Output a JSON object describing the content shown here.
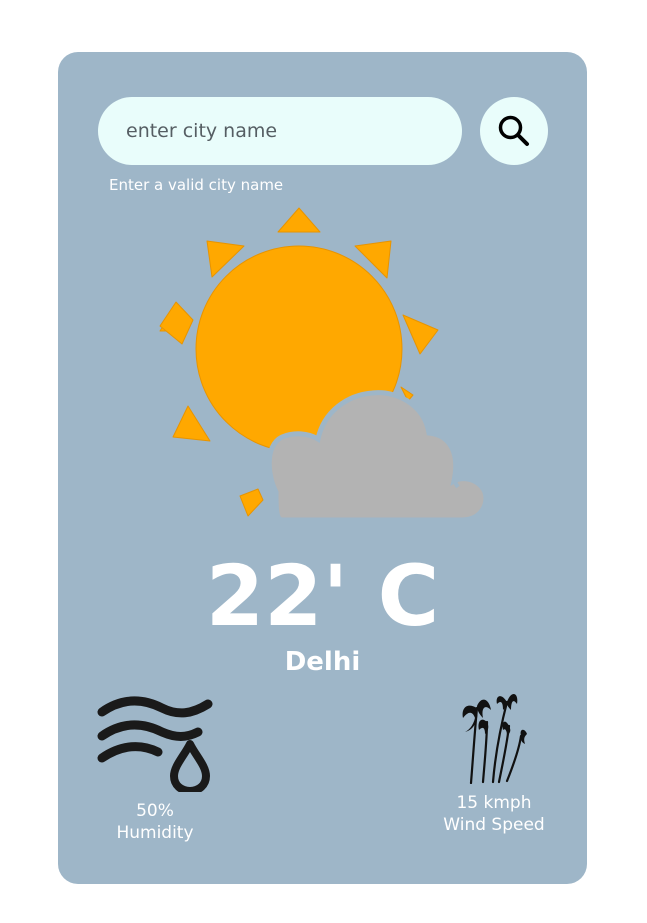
{
  "search": {
    "placeholder": "enter city name",
    "value": "",
    "error": "Enter a valid city name"
  },
  "weather": {
    "condition_icon": "partly-cloudy-icon",
    "temperature": "22' C",
    "city": "Delhi"
  },
  "stats": {
    "humidity": {
      "value": "50%",
      "label": "Humidity",
      "icon": "humidity-icon"
    },
    "wind": {
      "value": "15 kmph",
      "label": "Wind Speed",
      "icon": "wind-trees-icon"
    }
  },
  "colors": {
    "card_background": "#9eb6c8",
    "input_background": "#e9fdfb",
    "sun": "#ffa800",
    "cloud": "#b3b3b3",
    "text": "#ffffff"
  }
}
